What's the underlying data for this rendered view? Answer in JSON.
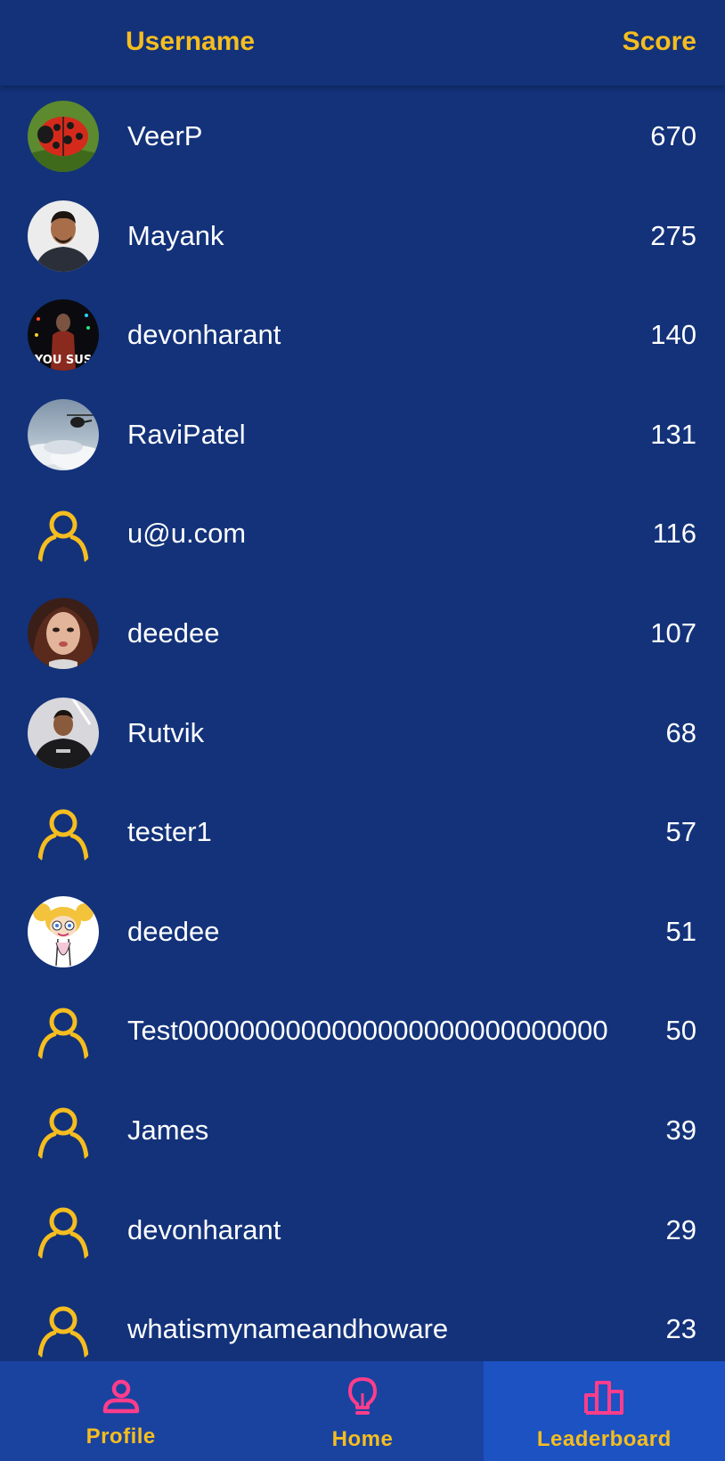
{
  "header": {
    "username_label": "Username",
    "score_label": "Score"
  },
  "rows": [
    {
      "username": "VeerP",
      "score": "670",
      "avatar": "ladybug-photo"
    },
    {
      "username": "Mayank",
      "score": "275",
      "avatar": "man-portrait-photo"
    },
    {
      "username": "devonharant",
      "score": "140",
      "avatar": "game-character-photo",
      "avatar_text": "YOU SUS"
    },
    {
      "username": "RaviPatel",
      "score": "131",
      "avatar": "helicopter-clouds-photo"
    },
    {
      "username": "u@u.com",
      "score": "116",
      "avatar": "default-user-icon"
    },
    {
      "username": "deedee",
      "score": "107",
      "avatar": "woman-portrait-photo"
    },
    {
      "username": "Rutvik",
      "score": "68",
      "avatar": "man-dark-sweatshirt-photo"
    },
    {
      "username": "tester1",
      "score": "57",
      "avatar": "default-user-icon"
    },
    {
      "username": "deedee",
      "score": "51",
      "avatar": "cartoon-girl-image"
    },
    {
      "username": "Test000000000000000000000000000000000000",
      "score": "50",
      "avatar": "default-user-icon"
    },
    {
      "username": "James",
      "score": "39",
      "avatar": "default-user-icon"
    },
    {
      "username": "devonharant",
      "score": "29",
      "avatar": "default-user-icon"
    },
    {
      "username": "whatismynameandhoware",
      "score": "23",
      "avatar": "default-user-icon"
    }
  ],
  "tabbar": {
    "tabs": [
      {
        "label": "Profile",
        "icon": "person-icon",
        "active": false
      },
      {
        "label": "Home",
        "icon": "lightbulb-icon",
        "active": false
      },
      {
        "label": "Leaderboard",
        "icon": "bar-chart-icon",
        "active": true
      }
    ]
  },
  "colors": {
    "background": "#13327a",
    "accent_yellow": "#f5bd1f",
    "tab_icon_pink": "#ff3d8b",
    "tabbar_bg": "#1a43a0",
    "tab_active_bg": "#1d52c2"
  }
}
